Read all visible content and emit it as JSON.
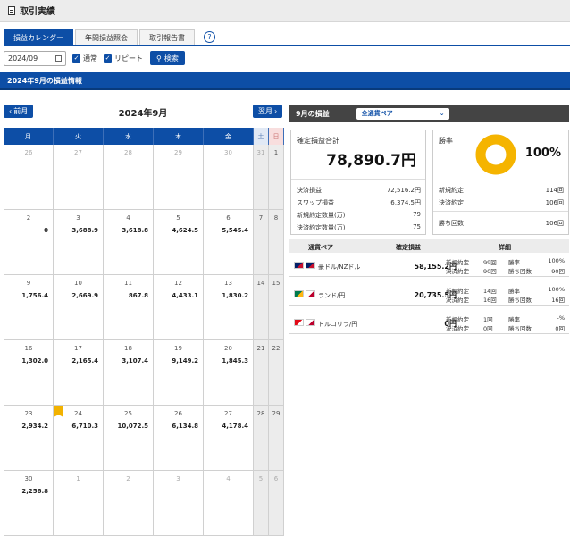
{
  "page": {
    "title": "取引実績"
  },
  "tabs": [
    "損益カレンダー",
    "年間損益照会",
    "取引報告書"
  ],
  "filter": {
    "month": "2024/09",
    "normal_label": "通常",
    "repeat_label": "リピート",
    "search_label": "検索"
  },
  "section_title": "2024年9月の損益情報",
  "calendar": {
    "prev_label": "前月",
    "next_label": "翌月",
    "title": "2024年9月",
    "weekdays": [
      "月",
      "火",
      "水",
      "木",
      "金",
      "土",
      "日"
    ],
    "weeks": [
      [
        {
          "d": "26",
          "v": "",
          "o": true
        },
        {
          "d": "27",
          "v": "",
          "o": true
        },
        {
          "d": "28",
          "v": "",
          "o": true
        },
        {
          "d": "29",
          "v": "",
          "o": true
        },
        {
          "d": "30",
          "v": "",
          "o": true
        },
        {
          "d": "31",
          "v": "",
          "o": true
        },
        {
          "d": "1",
          "v": ""
        }
      ],
      [
        {
          "d": "2",
          "v": "0"
        },
        {
          "d": "3",
          "v": "3,688.9"
        },
        {
          "d": "4",
          "v": "3,618.8"
        },
        {
          "d": "5",
          "v": "4,624.5"
        },
        {
          "d": "6",
          "v": "5,545.4"
        },
        {
          "d": "7",
          "v": ""
        },
        {
          "d": "8",
          "v": ""
        }
      ],
      [
        {
          "d": "9",
          "v": "1,756.4"
        },
        {
          "d": "10",
          "v": "2,669.9"
        },
        {
          "d": "11",
          "v": "867.8"
        },
        {
          "d": "12",
          "v": "4,433.1"
        },
        {
          "d": "13",
          "v": "1,830.2"
        },
        {
          "d": "14",
          "v": ""
        },
        {
          "d": "15",
          "v": ""
        }
      ],
      [
        {
          "d": "16",
          "v": "1,302.0"
        },
        {
          "d": "17",
          "v": "2,165.4"
        },
        {
          "d": "18",
          "v": "3,107.4"
        },
        {
          "d": "19",
          "v": "9,149.2"
        },
        {
          "d": "20",
          "v": "1,845.3"
        },
        {
          "d": "21",
          "v": ""
        },
        {
          "d": "22",
          "v": ""
        }
      ],
      [
        {
          "d": "23",
          "v": "2,934.2"
        },
        {
          "d": "24",
          "v": "6,710.3",
          "badge": true
        },
        {
          "d": "25",
          "v": "10,072.5"
        },
        {
          "d": "26",
          "v": "6,134.8"
        },
        {
          "d": "27",
          "v": "4,178.4"
        },
        {
          "d": "28",
          "v": ""
        },
        {
          "d": "29",
          "v": ""
        }
      ],
      [
        {
          "d": "30",
          "v": "2,256.8"
        },
        {
          "d": "1",
          "v": "",
          "o": true
        },
        {
          "d": "2",
          "v": "",
          "o": true
        },
        {
          "d": "3",
          "v": "",
          "o": true
        },
        {
          "d": "4",
          "v": "",
          "o": true
        },
        {
          "d": "5",
          "v": "",
          "o": true
        },
        {
          "d": "6",
          "v": "",
          "o": true
        }
      ]
    ]
  },
  "summary": {
    "header": "9月の損益",
    "pair_select": "全通貨ペア",
    "confirmed_label": "確定損益合計",
    "confirmed_value": "78,890.7円",
    "rows": [
      {
        "label": "決済損益",
        "value": "72,516.2円"
      },
      {
        "label": "スワップ損益",
        "value": "6,374.5円"
      },
      {
        "label": "新規約定数量(万)",
        "value": "79"
      },
      {
        "label": "決済約定数量(万)",
        "value": "75"
      }
    ],
    "win_label": "勝率",
    "win_pct": "100%",
    "win_fraction": 1.0,
    "win_rows": [
      {
        "label": "新規約定",
        "value": "114回"
      },
      {
        "label": "決済約定",
        "value": "106回"
      },
      {
        "label": "勝ち回数",
        "value": "106回"
      }
    ]
  },
  "table": {
    "headers": [
      "通貨ペア",
      "確定損益",
      "詳細"
    ],
    "rows": [
      {
        "name": "豪ドル/NZドル",
        "value": "58,155.2円",
        "new_label": "新規約定",
        "new": "99回",
        "close_label": "決済約定",
        "close": "90回",
        "rate_label": "勝率",
        "rate": "100%",
        "wins_label": "勝ち回数",
        "wins": "90回"
      },
      {
        "name": "ランド/円",
        "value": "20,735.5円",
        "new_label": "新規約定",
        "new": "14回",
        "close_label": "決済約定",
        "close": "16回",
        "rate_label": "勝率",
        "rate": "100%",
        "wins_label": "勝ち回数",
        "wins": "16回"
      },
      {
        "name": "トルコリラ/円",
        "value": "0円",
        "new_label": "新規約定",
        "new": "1回",
        "close_label": "決済約定",
        "close": "0回",
        "rate_label": "勝率",
        "rate": "-%",
        "wins_label": "勝ち回数",
        "wins": "0回"
      }
    ]
  },
  "colors": {
    "primary": "#0d4ea6",
    "donut": "#f5b400"
  }
}
